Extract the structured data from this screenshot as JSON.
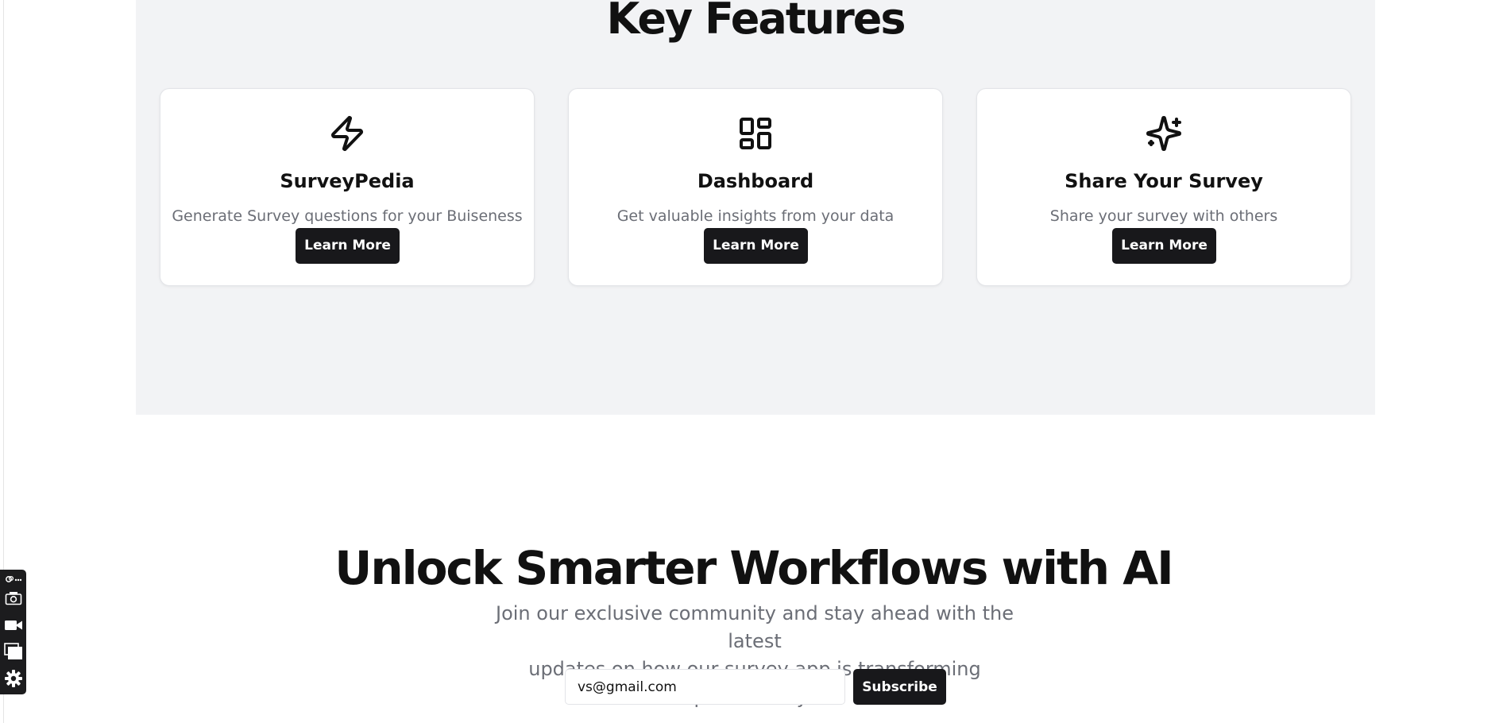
{
  "features": {
    "title": "Key Features",
    "cards": [
      {
        "icon": "lightning-icon",
        "title": "SurveyPedia",
        "description": "Generate Survey questions for your Buiseness",
        "button_label": "Learn More"
      },
      {
        "icon": "dashboard-icon",
        "title": "Dashboard",
        "description": "Get valuable insights from your data",
        "button_label": "Learn More"
      },
      {
        "icon": "sparkles-icon",
        "title": "Share Your Survey",
        "description": "Share your survey with others",
        "button_label": "Learn More"
      }
    ]
  },
  "cta": {
    "title": "Unlock Smarter Workflows with AI",
    "description_line1": "Join our exclusive community and stay ahead with the latest",
    "description_line2": "updates on how our survey app is transforming productivity!",
    "email_value": "vs@gmail.com",
    "subscribe_label": "Subscribe"
  },
  "toolbar": {
    "tools": [
      "link-more-icon",
      "camera-icon",
      "video-icon",
      "window-icon",
      "gear-icon"
    ]
  },
  "colors": {
    "section_bg": "#f2f3f5",
    "button_bg": "#18181b",
    "muted_text": "#6b6e76"
  }
}
